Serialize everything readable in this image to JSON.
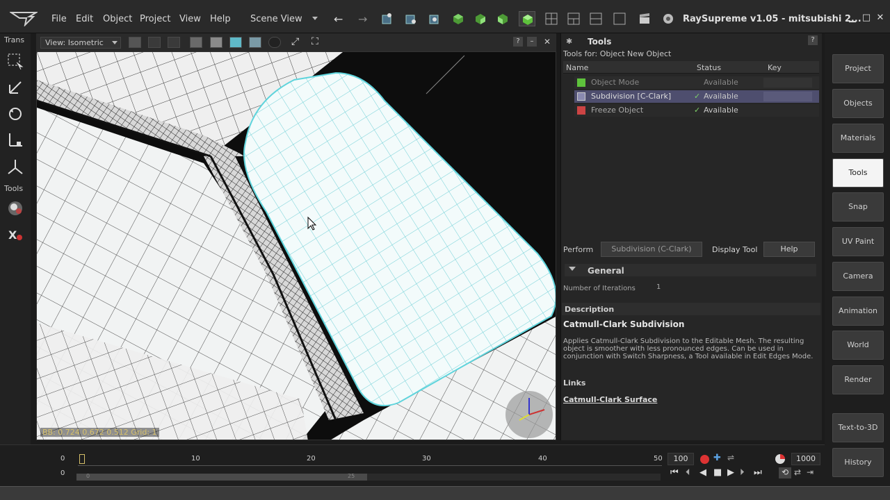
{
  "menu": {
    "file": "File",
    "edit": "Edit",
    "object": "Object",
    "project": "Project",
    "view": "View",
    "help": "Help"
  },
  "scene_view": "Scene View",
  "app_title": "RaySupreme v1.05 - mitsubishi 2...",
  "left_toolbar": {
    "trans_label": "Trans",
    "tools_label": "Tools"
  },
  "viewport": {
    "view_select": "View: Isometric",
    "bb_info": "BB: 0.724 0.672 0.512  Grid: 1"
  },
  "tools_panel": {
    "title": "Tools",
    "tools_for": "Tools for: Object  New Object",
    "columns": {
      "name": "Name",
      "status": "Status",
      "key": "Key"
    },
    "rows": [
      {
        "name": "Object Mode",
        "status": "Available",
        "key": ""
      },
      {
        "name": "Subdivision [C-Clark]",
        "status": "Available",
        "key": ""
      },
      {
        "name": "Freeze Object",
        "status": "Available",
        "key": ""
      }
    ],
    "perform_label": "Perform",
    "perform_tool": "Subdivision (C-Clark)",
    "display_tool": "Display Tool",
    "help": "Help",
    "general": "General",
    "iterations_label": "Number of Iterations",
    "iterations_value": "1",
    "description_hdr": "Description",
    "description_title": "Catmull-Clark Subdivision",
    "description_text": "Applies Catmull-Clark Subdivision to the Editable Mesh. The resulting object is smoother with less pronounced edges. Can be used in conjunction with Switch Sharpness, a Tool available in Edit Edges Mode.",
    "links_label": "Links",
    "link_text": "Catmull-Clark Surface"
  },
  "right_tabs": [
    "Project",
    "Objects",
    "Materials",
    "Tools",
    "Snap",
    "UV Paint",
    "Camera",
    "Animation",
    "World",
    "Render",
    "Text-to-3D",
    "History"
  ],
  "active_tab": "Tools",
  "timeline": {
    "start_top": "0",
    "start_bottom": "0",
    "ticks": [
      "10",
      "20",
      "30",
      "40",
      "50"
    ],
    "frame_value": "100",
    "end_value": "1000",
    "scrub_left": "0",
    "scrub_mid": "25"
  },
  "colors": {
    "accent_green": "#5ec23c",
    "active_tab": "#f4f4f4",
    "mesh_cyan": "#5fd4dc"
  }
}
